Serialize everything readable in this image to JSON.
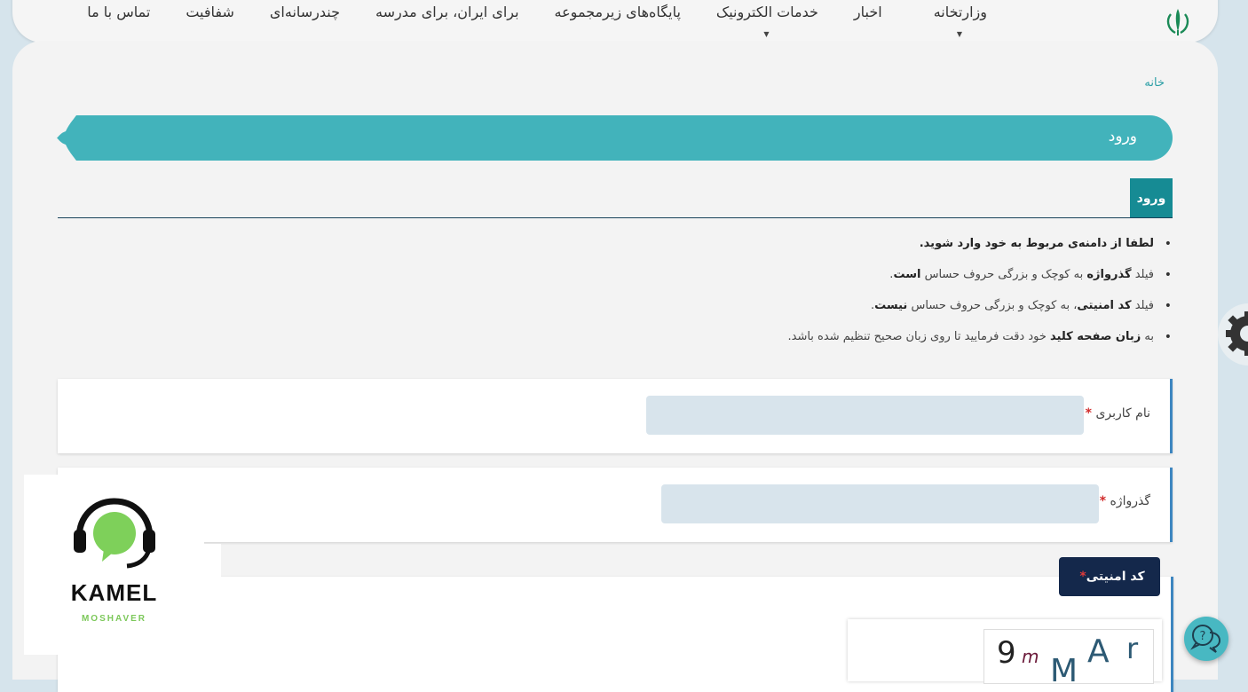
{
  "nav": {
    "items": [
      {
        "label": "وزارتخانه",
        "dropdown": true
      },
      {
        "label": "اخبار",
        "dropdown": false
      },
      {
        "label": "خدمات الکترونیک",
        "dropdown": true
      },
      {
        "label": "پایگاه‌های زیرمجموعه",
        "dropdown": false
      },
      {
        "label": "برای ایران، برای مدرسه",
        "dropdown": false
      },
      {
        "label": "چندرسانه‌ای",
        "dropdown": false
      },
      {
        "label": "شفافیت",
        "dropdown": false
      },
      {
        "label": "تماس با ما",
        "dropdown": false
      }
    ]
  },
  "breadcrumb": {
    "home": "خانه"
  },
  "page": {
    "title": "ورود",
    "tab_label": "ورود"
  },
  "notes": {
    "n1": "لطفا از دامنه‌ی مربوط به خود وارد شوید.",
    "n2_pre": "فیلد ",
    "n2_bold1": "گذرواژه",
    "n2_mid": " به کوچک و بزرگی حروف حساس ",
    "n2_bold2": "است",
    "n2_end": ".",
    "n3_pre": "فیلد ",
    "n3_bold1": "کد امنیتی",
    "n3_mid": "، به کوچک و بزرگی حروف حساس ",
    "n3_bold2": "نیست",
    "n3_end": ".",
    "n4_pre": "به ",
    "n4_bold1": "زبان صفحه کلید",
    "n4_mid": " خود دقت فرمایید تا روی زبان صحیح تنظیم شده باشد."
  },
  "form": {
    "username_label": "نام کاربری",
    "username_value": "",
    "password_label": "گذرواژه",
    "password_value": "",
    "required_mark": "*",
    "captcha_label": "کد امنیتی",
    "captcha_chars": [
      "9",
      "m",
      "M",
      "A",
      "r"
    ]
  },
  "logo": {
    "name": "KAMEL",
    "sub": "MOSHAVER"
  },
  "colors": {
    "accent": "#42b3bb",
    "tab": "#168b94",
    "captcha_tab": "#14284b",
    "required": "#d12c2c"
  },
  "icons": {
    "emblem": "iran-emblem-icon",
    "gear": "gear-icon",
    "chat": "chat-help-icon",
    "headset": "headset-icon"
  }
}
